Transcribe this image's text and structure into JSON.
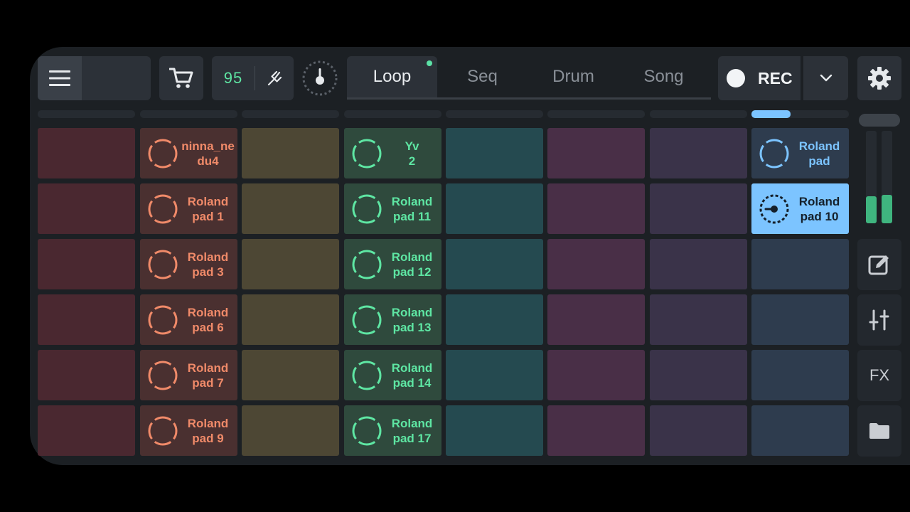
{
  "toolbar": {
    "bpm": "95",
    "record_label": "REC"
  },
  "tabs": [
    {
      "label": "Loop",
      "active": true
    },
    {
      "label": "Seq",
      "active": false
    },
    {
      "label": "Drum",
      "active": false
    },
    {
      "label": "Song",
      "active": false
    }
  ],
  "colors": {
    "col1": "#4a2830",
    "col2": "#4a3030",
    "col3": "#4d4734",
    "col4": "#2f4a3d",
    "col5": "#254a50",
    "col6": "#492f47",
    "col7": "#3a3349",
    "col8": "#2e3c4e",
    "accent_orange": "#f08a69",
    "accent_green": "#5ee6a3",
    "accent_blue": "#7cc4ff",
    "pad_active": "#7cc4ff"
  },
  "grid": {
    "col2": [
      "ninna_ne du4",
      "Roland pad 1",
      "Roland pad 3",
      "Roland pad 6",
      "Roland pad 7",
      "Roland pad 9"
    ],
    "col4": [
      "Yv 2",
      "Roland pad 11",
      "Roland pad 12",
      "Roland pad 13",
      "Roland pad 14",
      "Roland pad 17"
    ],
    "col8": [
      "Roland pad",
      "Roland pad 10"
    ]
  },
  "col2_lines": [
    [
      "ninna_ne",
      "du4"
    ],
    [
      "Roland",
      "pad 1"
    ],
    [
      "Roland",
      "pad 3"
    ],
    [
      "Roland",
      "pad 6"
    ],
    [
      "Roland",
      "pad 7"
    ],
    [
      "Roland",
      "pad 9"
    ]
  ],
  "col4_lines": [
    [
      "Yv",
      "2"
    ],
    [
      "Roland",
      "pad 11"
    ],
    [
      "Roland",
      "pad 12"
    ],
    [
      "Roland",
      "pad 13"
    ],
    [
      "Roland",
      "pad 14"
    ],
    [
      "Roland",
      "pad 17"
    ]
  ],
  "col8_lines": [
    [
      "Roland",
      "pad"
    ],
    [
      "Roland",
      "pad 10"
    ]
  ],
  "sidebar": {
    "fx_label": "FX"
  }
}
